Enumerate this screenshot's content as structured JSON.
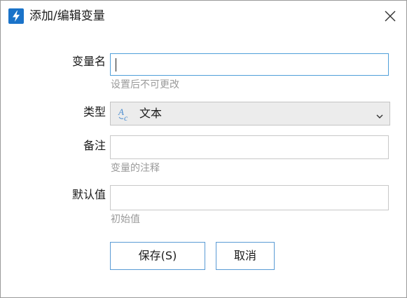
{
  "window": {
    "title": "添加/编辑变量",
    "app_icon": "lightning-bolt-icon",
    "close_icon": "close-icon"
  },
  "form": {
    "variable_name": {
      "label": "变量名",
      "value": "",
      "hint": "设置后不可更改"
    },
    "type": {
      "label": "类型",
      "selected": "文本",
      "icon": "text-type-icon"
    },
    "note": {
      "label": "备注",
      "value": "",
      "hint": "变量的注释"
    },
    "default_value": {
      "label": "默认值",
      "value": "",
      "hint": "初始值"
    }
  },
  "buttons": {
    "save": "保存(S)",
    "cancel": "取消"
  },
  "colors": {
    "accent": "#1a73c9",
    "focus_border": "#4f9fd9",
    "button_border": "#5a9bd5",
    "hint_text": "#9a9a9a"
  }
}
